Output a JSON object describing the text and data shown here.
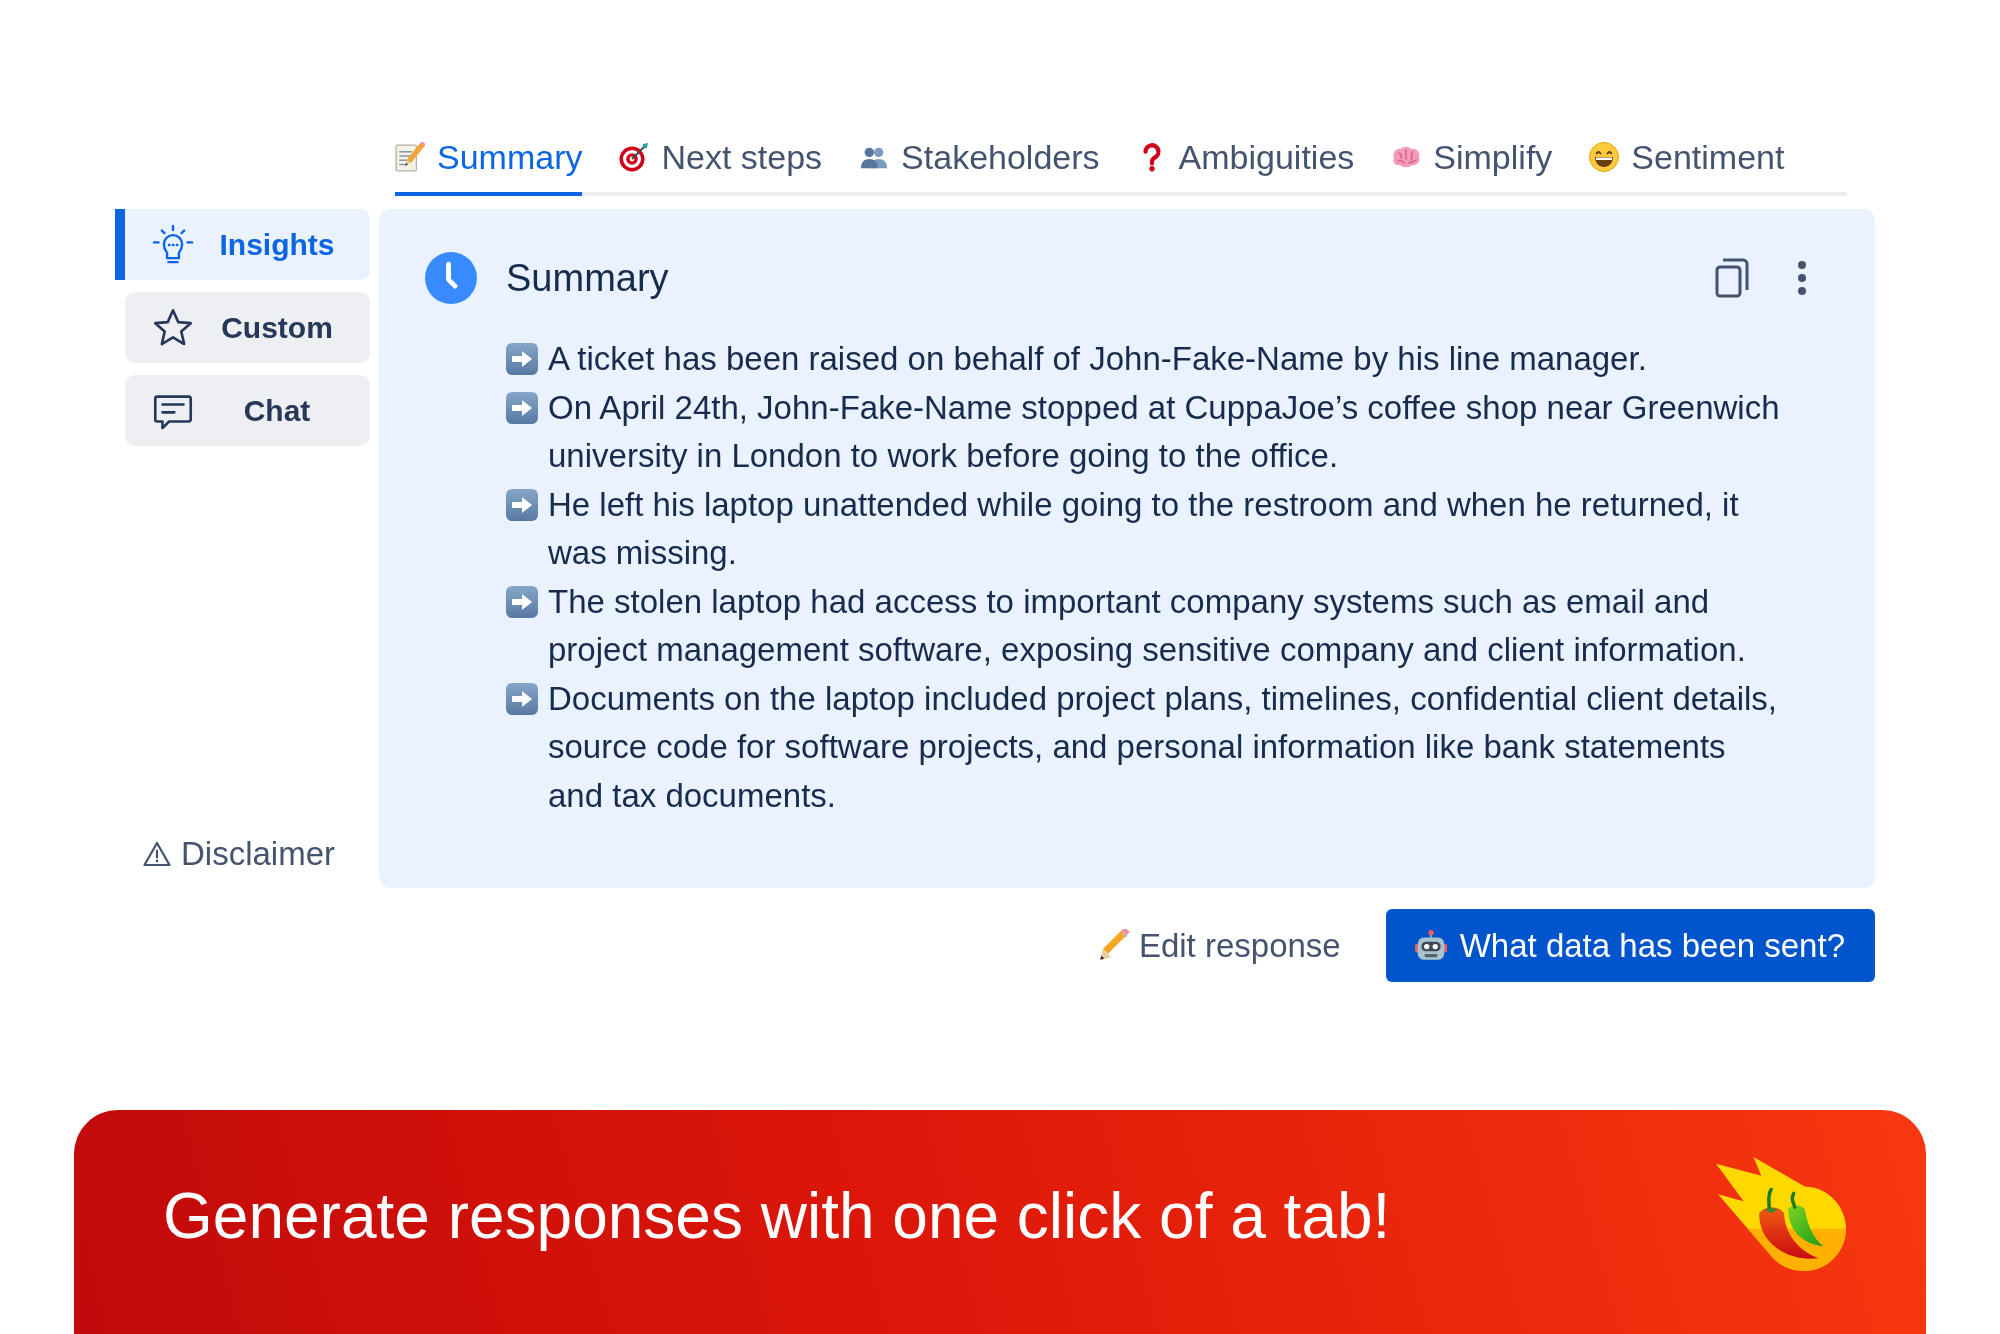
{
  "tabs": [
    {
      "label": "Summary",
      "selected": true
    },
    {
      "label": "Next steps",
      "selected": false
    },
    {
      "label": "Stakeholders",
      "selected": false
    },
    {
      "label": "Ambiguities",
      "selected": false
    },
    {
      "label": "Simplify",
      "selected": false
    },
    {
      "label": "Sentiment",
      "selected": false
    }
  ],
  "sidebar": {
    "items": [
      {
        "label": "Insights",
        "selected": true
      },
      {
        "label": "Custom",
        "selected": false
      },
      {
        "label": "Chat",
        "selected": false
      }
    ],
    "disclaimer": "Disclaimer"
  },
  "summary_card": {
    "title": "Summary",
    "points": [
      "A ticket has been raised on behalf of John-Fake-Name by his line manager.",
      "On April 24th, John-Fake-Name stopped at CuppaJoe’s coffee shop near Greenwich university in London to work before going to the office.",
      "He left his laptop unattended while going to the restroom and when he returned, it was missing.",
      "The stolen laptop had access to important company systems such as email and project management software, exposing sensitive company and client information.",
      "Documents on the laptop included project plans, timelines, confidential client details, source code for software projects, and personal information like bank statements and tax documents."
    ]
  },
  "actions": {
    "edit_button": "Edit response",
    "data_button": "What data has been sent?"
  },
  "banner": {
    "text": "Generate responses with one click of a tab!"
  }
}
